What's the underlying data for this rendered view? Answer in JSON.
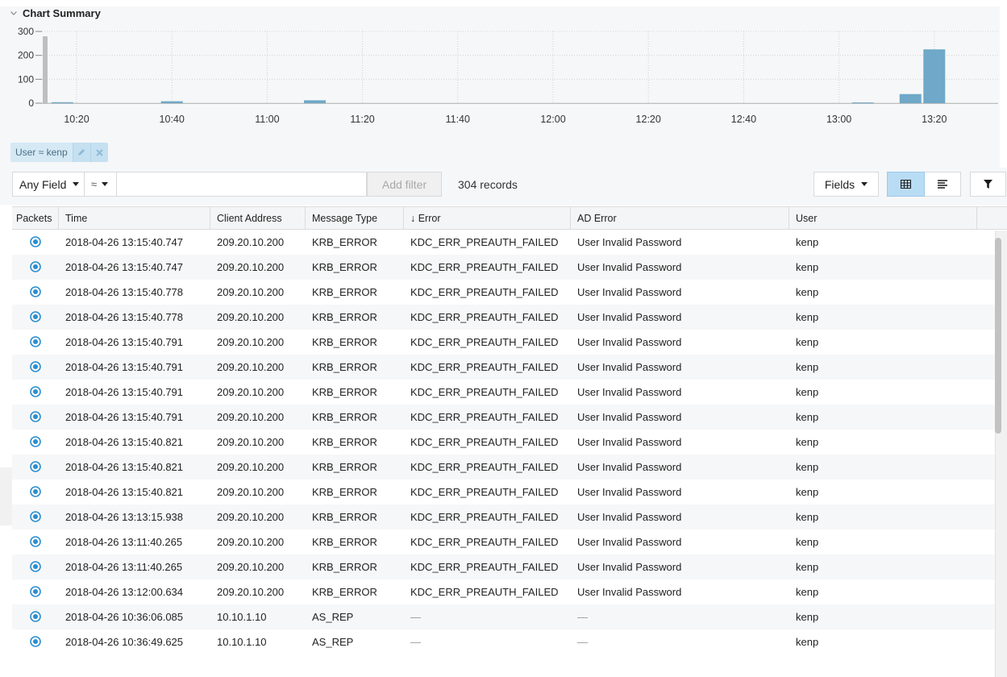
{
  "summary": {
    "title": "Chart Summary"
  },
  "chart_data": {
    "type": "bar",
    "y_ticks": [
      "0",
      "100",
      "200",
      "300"
    ],
    "x_ticks": [
      "10:20",
      "10:40",
      "11:00",
      "11:20",
      "11:40",
      "12:00",
      "12:20",
      "12:40",
      "13:00",
      "13:20"
    ],
    "ylim": [
      0,
      300
    ],
    "bars": [
      {
        "time": "10:17",
        "value": 4
      },
      {
        "time": "10:40",
        "value": 8
      },
      {
        "time": "11:10",
        "value": 12
      },
      {
        "time": "13:05",
        "value": 3
      },
      {
        "time": "13:15",
        "value": 38
      },
      {
        "time": "13:20",
        "value": 225
      }
    ],
    "grid": true,
    "color": "#6fa8c8"
  },
  "chip": {
    "label": "User ≈ kenp"
  },
  "toolbar": {
    "field_select": "Any Field",
    "operator": "≈",
    "filter_placeholder": "",
    "add_filter_label": "Add filter",
    "records": "304 records",
    "fields_label": "Fields"
  },
  "table": {
    "columns": [
      "Packets",
      "Time",
      "Client Address",
      "Message Type",
      "↓ Error",
      "AD Error",
      "User"
    ],
    "rows": [
      {
        "time": "2018-04-26 13:15:40.747",
        "client": "209.20.10.200",
        "type": "KRB_ERROR",
        "error": "KDC_ERR_PREAUTH_FAILED",
        "ad": "User Invalid Password",
        "user": "kenp"
      },
      {
        "time": "2018-04-26 13:15:40.747",
        "client": "209.20.10.200",
        "type": "KRB_ERROR",
        "error": "KDC_ERR_PREAUTH_FAILED",
        "ad": "User Invalid Password",
        "user": "kenp"
      },
      {
        "time": "2018-04-26 13:15:40.778",
        "client": "209.20.10.200",
        "type": "KRB_ERROR",
        "error": "KDC_ERR_PREAUTH_FAILED",
        "ad": "User Invalid Password",
        "user": "kenp"
      },
      {
        "time": "2018-04-26 13:15:40.778",
        "client": "209.20.10.200",
        "type": "KRB_ERROR",
        "error": "KDC_ERR_PREAUTH_FAILED",
        "ad": "User Invalid Password",
        "user": "kenp"
      },
      {
        "time": "2018-04-26 13:15:40.791",
        "client": "209.20.10.200",
        "type": "KRB_ERROR",
        "error": "KDC_ERR_PREAUTH_FAILED",
        "ad": "User Invalid Password",
        "user": "kenp"
      },
      {
        "time": "2018-04-26 13:15:40.791",
        "client": "209.20.10.200",
        "type": "KRB_ERROR",
        "error": "KDC_ERR_PREAUTH_FAILED",
        "ad": "User Invalid Password",
        "user": "kenp"
      },
      {
        "time": "2018-04-26 13:15:40.791",
        "client": "209.20.10.200",
        "type": "KRB_ERROR",
        "error": "KDC_ERR_PREAUTH_FAILED",
        "ad": "User Invalid Password",
        "user": "kenp"
      },
      {
        "time": "2018-04-26 13:15:40.791",
        "client": "209.20.10.200",
        "type": "KRB_ERROR",
        "error": "KDC_ERR_PREAUTH_FAILED",
        "ad": "User Invalid Password",
        "user": "kenp"
      },
      {
        "time": "2018-04-26 13:15:40.821",
        "client": "209.20.10.200",
        "type": "KRB_ERROR",
        "error": "KDC_ERR_PREAUTH_FAILED",
        "ad": "User Invalid Password",
        "user": "kenp"
      },
      {
        "time": "2018-04-26 13:15:40.821",
        "client": "209.20.10.200",
        "type": "KRB_ERROR",
        "error": "KDC_ERR_PREAUTH_FAILED",
        "ad": "User Invalid Password",
        "user": "kenp"
      },
      {
        "time": "2018-04-26 13:15:40.821",
        "client": "209.20.10.200",
        "type": "KRB_ERROR",
        "error": "KDC_ERR_PREAUTH_FAILED",
        "ad": "User Invalid Password",
        "user": "kenp"
      },
      {
        "time": "2018-04-26 13:13:15.938",
        "client": "209.20.10.200",
        "type": "KRB_ERROR",
        "error": "KDC_ERR_PREAUTH_FAILED",
        "ad": "User Invalid Password",
        "user": "kenp"
      },
      {
        "time": "2018-04-26 13:11:40.265",
        "client": "209.20.10.200",
        "type": "KRB_ERROR",
        "error": "KDC_ERR_PREAUTH_FAILED",
        "ad": "User Invalid Password",
        "user": "kenp"
      },
      {
        "time": "2018-04-26 13:11:40.265",
        "client": "209.20.10.200",
        "type": "KRB_ERROR",
        "error": "KDC_ERR_PREAUTH_FAILED",
        "ad": "User Invalid Password",
        "user": "kenp"
      },
      {
        "time": "2018-04-26 13:12:00.634",
        "client": "209.20.10.200",
        "type": "KRB_ERROR",
        "error": "KDC_ERR_PREAUTH_FAILED",
        "ad": "User Invalid Password",
        "user": "kenp"
      },
      {
        "time": "2018-04-26 10:36:06.085",
        "client": "10.10.1.10",
        "type": "AS_REP",
        "error": "—",
        "ad": "—",
        "user": "kenp"
      },
      {
        "time": "2018-04-26 10:36:49.625",
        "client": "10.10.1.10",
        "type": "AS_REP",
        "error": "—",
        "ad": "—",
        "user": "kenp"
      }
    ]
  },
  "icons": {
    "packets": "packets-target-icon",
    "chip_edit": "pencil-icon",
    "chip_remove": "close-icon",
    "grid_view": "table-grid-icon",
    "list_view": "list-lines-icon",
    "filter": "funnel-icon",
    "collapse": "chevron-down-icon"
  },
  "colors": {
    "accent": "#2b8fd0",
    "bar": "#6fa8c8",
    "chip_bg": "#d5e9f4",
    "selected_view": "#b9dcf5"
  }
}
